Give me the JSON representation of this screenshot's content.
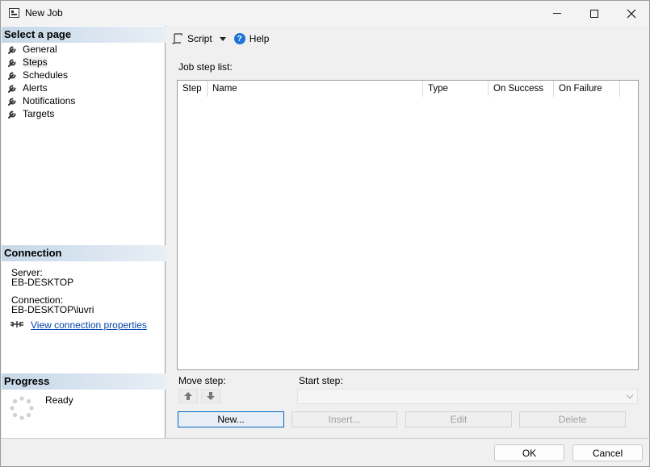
{
  "window": {
    "title": "New Job"
  },
  "left_pane": {
    "select_page_header": "Select a page",
    "pages": [
      {
        "label": "General",
        "icon": "wrench-icon"
      },
      {
        "label": "Steps",
        "icon": "wrench-icon"
      },
      {
        "label": "Schedules",
        "icon": "wrench-icon"
      },
      {
        "label": "Alerts",
        "icon": "wrench-icon"
      },
      {
        "label": "Notifications",
        "icon": "wrench-icon"
      },
      {
        "label": "Targets",
        "icon": "wrench-icon"
      }
    ],
    "connection_header": "Connection",
    "server_label": "Server:",
    "server_value": "EB-DESKTOP",
    "connection_label": "Connection:",
    "connection_value": "EB-DESKTOP\\luvri",
    "view_connection_link": "View connection properties",
    "progress_header": "Progress",
    "progress_status": "Ready"
  },
  "toolbar": {
    "script_label": "Script",
    "help_label": "Help"
  },
  "main": {
    "job_step_list_label": "Job step list:",
    "columns": [
      "Step",
      "Name",
      "Type",
      "On Success",
      "On Failure"
    ],
    "move_step_label": "Move step:",
    "start_step_label": "Start step:",
    "start_step_value": "",
    "buttons": {
      "new": "New...",
      "insert": "Insert...",
      "edit": "Edit",
      "delete": "Delete"
    }
  },
  "footer": {
    "ok": "OK",
    "cancel": "Cancel"
  },
  "colors": {
    "header_gradient_start": "#c6d7e8",
    "link": "#0645ad",
    "primary_border": "#0067c0"
  }
}
